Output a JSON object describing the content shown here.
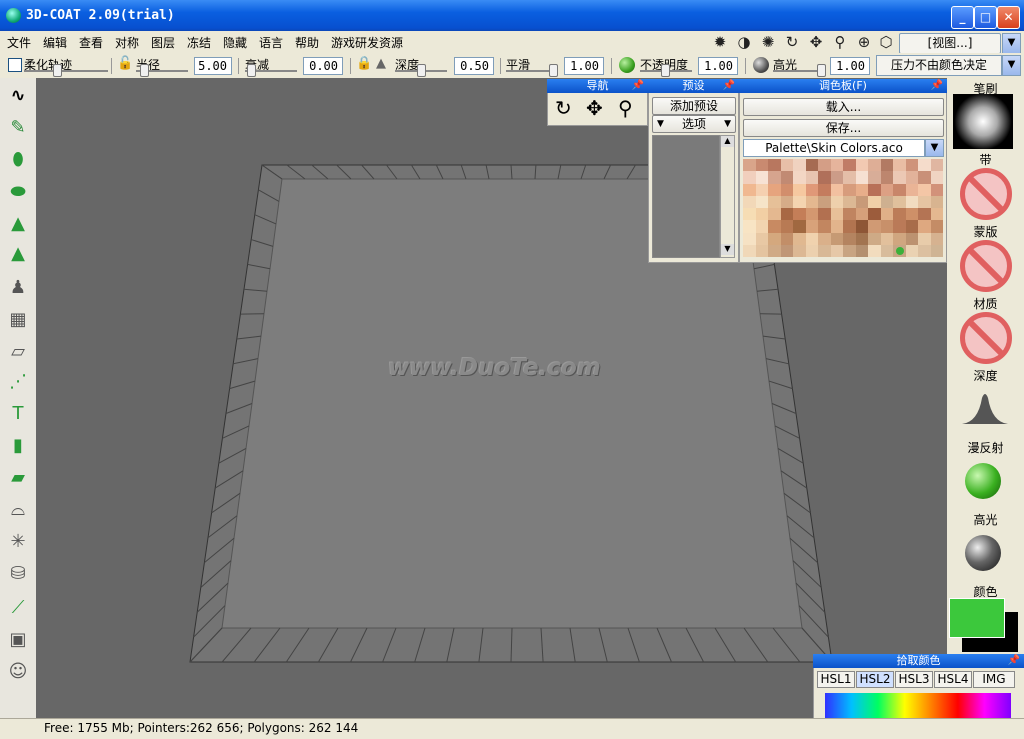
{
  "window": {
    "title": "3D-COAT 2.09(trial)"
  },
  "menu": [
    "文件",
    "编辑",
    "查看",
    "对称",
    "图层",
    "冻结",
    "隐藏",
    "语言",
    "帮助",
    "游戏研发资源"
  ],
  "toolbar_right": {
    "view_label": "[视图...]",
    "icons": [
      "sun-icon",
      "contrast-icon",
      "light-icon",
      "rotate-icon",
      "move-icon",
      "zoom-icon",
      "target-icon",
      "cube-icon"
    ]
  },
  "params": {
    "soften_label": "柔化轨迹",
    "radius_label": "半径",
    "radius_value": "5.00",
    "falloff_label": "衰减",
    "falloff_value": "0.00",
    "depth_label": "深度",
    "depth_value": "0.50",
    "smooth_label": "平滑",
    "smooth_value": "1.00",
    "opacity_label": "不透明度",
    "opacity_value": "1.00",
    "gloss_label": "高光",
    "gloss_value": "1.00",
    "pressure_label": "压力不由颜色决定"
  },
  "left_tools": [
    "stroke-tool-icon",
    "brush-tool-icon",
    "spray-tool-icon",
    "fill-tool-icon",
    "cone-tool-icon",
    "cone-alt-tool-icon",
    "stamp-tool-icon",
    "grid-tool-icon",
    "plane-tool-icon",
    "curve-tool-icon",
    "text-tool-icon",
    "layer-tool-icon",
    "eraser-tool-icon",
    "hat-tool-icon",
    "star-tool-icon",
    "bucket-tool-icon",
    "pen-tool-icon",
    "image-tool-icon",
    "head-tool-icon"
  ],
  "viewport": {
    "watermark": "www.DuoTe.com"
  },
  "nav_panel": {
    "title": "导航"
  },
  "preset_panel": {
    "title": "预设",
    "add_label": "添加预设",
    "options_label": "选项"
  },
  "palette_panel": {
    "title": "调色板(F)",
    "load_label": "载入...",
    "save_label": "保存...",
    "file_label": "Palette\\Skin Colors.aco",
    "swatches": [
      "#d9a58a",
      "#c98a70",
      "#b8775f",
      "#e8bfa8",
      "#f0d2c0",
      "#a66b52",
      "#d49e86",
      "#e6b49c",
      "#c07c66",
      "#f2c9b2",
      "#deae96",
      "#b27a63",
      "#e9bda4",
      "#cf937a",
      "#f5dccb",
      "#e0b6a1",
      "#f1cfbd",
      "#f7e2d4",
      "#d6a48e",
      "#c18a73",
      "#f3d6c4",
      "#e8c4b0",
      "#b0705a",
      "#cc9c88",
      "#e4bea8",
      "#f6e0d2",
      "#d8ad98",
      "#bd866e",
      "#ecc8b4",
      "#e2b29a",
      "#c99078",
      "#f0d4c2",
      "#f0b890",
      "#f5d0b0",
      "#e6a47e",
      "#d28e6c",
      "#f6c8a0",
      "#e09878",
      "#c47c5e",
      "#f2c0a0",
      "#d79c7c",
      "#e8ae8a",
      "#b87058",
      "#dca084",
      "#c8866a",
      "#eab496",
      "#f4c6a6",
      "#d2927a",
      "#f2d8b8",
      "#f6e4c8",
      "#e6c098",
      "#d6ac88",
      "#f4d4b0",
      "#e4b890",
      "#caa07e",
      "#eed0ac",
      "#dcb894",
      "#c89a78",
      "#f0d0a8",
      "#ceb090",
      "#e0c09c",
      "#f2dcc0",
      "#e6c4a2",
      "#d8b490",
      "#f6ddb4",
      "#f2cfa4",
      "#e4b890",
      "#a86844",
      "#c47e58",
      "#d49870",
      "#b27050",
      "#e8c098",
      "#c08460",
      "#d6a07a",
      "#9c5c3c",
      "#e0b088",
      "#bc7c58",
      "#ce9068",
      "#b47454",
      "#e4b890",
      "#f8e4c4",
      "#f2d4b0",
      "#c88a62",
      "#b87a54",
      "#a06840",
      "#d8a27a",
      "#c28660",
      "#e2b48c",
      "#b27450",
      "#8e5636",
      "#d09a74",
      "#c8906a",
      "#ba7a58",
      "#a86c4a",
      "#dea880",
      "#c48c66",
      "#f6e2c4",
      "#e8c8a4",
      "#d4a87e",
      "#c28e68",
      "#e0b890",
      "#f0d2ae",
      "#dab08a",
      "#c69a74",
      "#b48460",
      "#a27450",
      "#ceaa86",
      "#e2c09c",
      "#d0a680",
      "#bc9270",
      "#e8ccaa",
      "#d6b290",
      "#f0d8b8",
      "#e4c4a0",
      "#d0aa86",
      "#c09676",
      "#dcb894",
      "#ecd0ae",
      "#d8b896",
      "#e6c8a8",
      "#c8a482",
      "#b49070",
      "#f2dcbe",
      "#d8bc9c",
      "#c6a684",
      "#ead2b2",
      "#dcc0a0",
      "#cfb494"
    ]
  },
  "right_panel": {
    "brush_label": "笔刷",
    "band_label": "带",
    "mask_label": "蒙版",
    "material_label": "材质",
    "depth_label": "深度",
    "diffuse_label": "漫反射",
    "gloss_label": "高光",
    "color_label": "颜色",
    "current_color": "#3cc83c",
    "secondary_color": "#000000"
  },
  "color_picker": {
    "title": "拾取颜色",
    "tabs": [
      "HSL1",
      "HSL2",
      "HSL3",
      "HSL4",
      "IMG"
    ],
    "selected_tab": "HSL2"
  },
  "status": {
    "text": "Free: 1755 Mb; Pointers:262 656; Polygons: 262 144"
  }
}
